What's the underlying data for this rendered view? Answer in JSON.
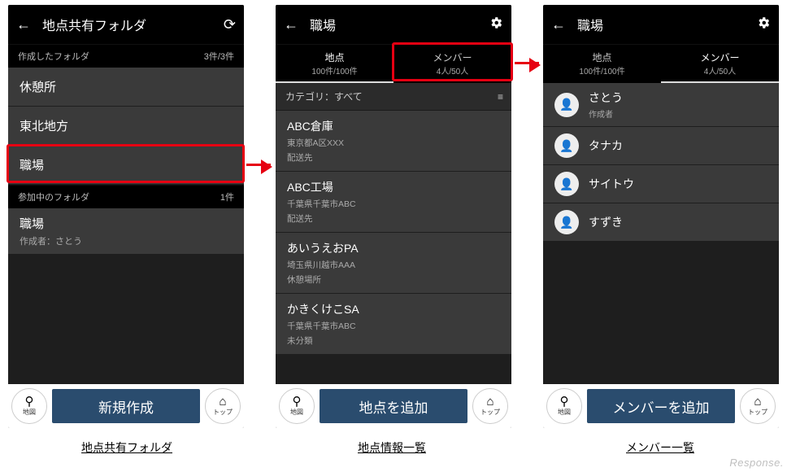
{
  "screen1": {
    "title": "地点共有フォルダ",
    "section1_label": "作成したフォルダ",
    "section1_count": "3件/3件",
    "folders_created": [
      "休憩所",
      "東北地方",
      "職場"
    ],
    "section2_label": "参加中のフォルダ",
    "section2_count": "1件",
    "joined_folder_name": "職場",
    "joined_folder_sub": "作成者：さとう",
    "bottom_main": "新規作成",
    "map_btn": "地図",
    "top_btn": "トップ"
  },
  "screen2": {
    "title": "職場",
    "tab1_label": "地点",
    "tab1_count": "100件/100件",
    "tab2_label": "メンバー",
    "tab2_count": "4人/50人",
    "category_bar": "カテゴリ：すべて",
    "pois": [
      {
        "name": "ABC倉庫",
        "addr": "東京都A区XXX",
        "tag": "配送先"
      },
      {
        "name": "ABC工場",
        "addr": "千葉県千葉市ABC",
        "tag": "配送先"
      },
      {
        "name": "あいうえおPA",
        "addr": "埼玉県川越市AAA",
        "tag": "休憩場所"
      },
      {
        "name": "かきくけこSA",
        "addr": "千葉県千葉市ABC",
        "tag": "未分類"
      }
    ],
    "bottom_main": "地点を追加",
    "map_btn": "地図",
    "top_btn": "トップ"
  },
  "screen3": {
    "title": "職場",
    "tab1_label": "地点",
    "tab1_count": "100件/100件",
    "tab2_label": "メンバー",
    "tab2_count": "4人/50人",
    "members": [
      {
        "name": "さとう",
        "role": "作成者"
      },
      {
        "name": "タナカ",
        "role": ""
      },
      {
        "name": "サイトウ",
        "role": ""
      },
      {
        "name": "すずき",
        "role": ""
      }
    ],
    "bottom_main": "メンバーを追加",
    "map_btn": "地図",
    "top_btn": "トップ"
  },
  "captions": {
    "c1": "地点共有フォルダ",
    "c2": "地点情報一覧",
    "c3": "メンバー一覧"
  },
  "watermark": "Response."
}
